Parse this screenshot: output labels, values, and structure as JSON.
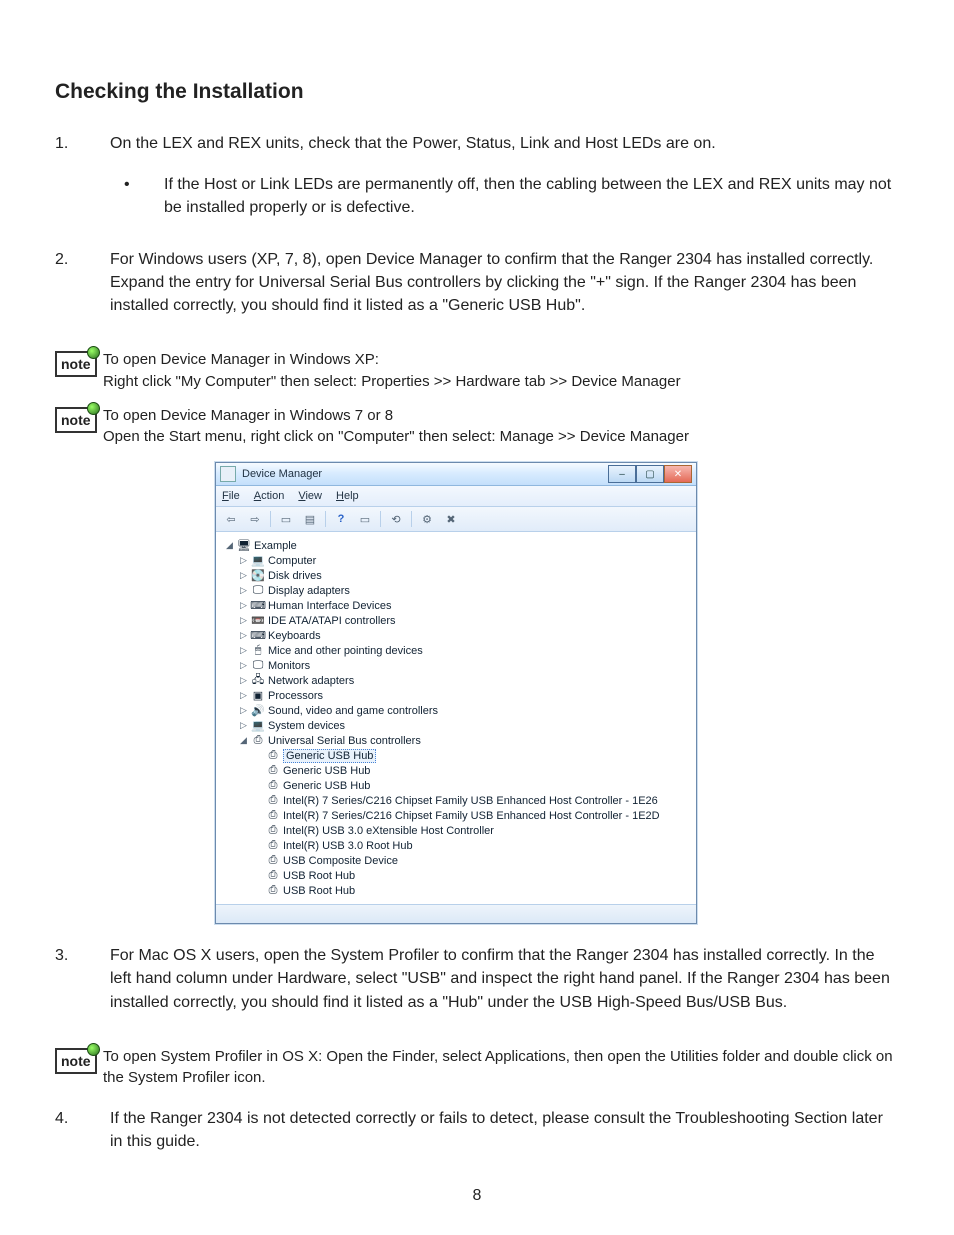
{
  "heading": "Checking the Installation",
  "items": {
    "i1": {
      "num": "1.",
      "text": "On the LEX and REX units, check that the Power, Status, Link and Host LEDs are on."
    },
    "i1b": {
      "text": "If the Host or Link LEDs are permanently off, then the cabling between the LEX and REX units may not be installed properly or is defective."
    },
    "i2": {
      "num": "2.",
      "text": "For Windows users (XP, 7, 8), open Device Manager to confirm that the Ranger 2304 has installed correctly. Expand the entry for Universal Serial Bus controllers by clicking the \"+\" sign. If the Ranger 2304 has been installed correctly, you should find it listed as a \"Generic USB Hub\"."
    },
    "i3": {
      "num": "3.",
      "text": "For Mac OS X users, open the System Profiler to confirm that the Ranger 2304 has installed correctly. In the left hand column under Hardware, select \"USB\" and inspect the right hand panel. If the Ranger 2304 has been installed correctly, you should find it listed as a \"Hub\" under the USB High-Speed Bus/USB Bus."
    },
    "i4": {
      "num": "4.",
      "text": "If the Ranger 2304 is not detected correctly or fails to detect, please consult the Troubleshooting Section later in this  guide."
    }
  },
  "notes": {
    "label": "note",
    "n1a": "To open Device Manager in Windows XP:",
    "n1b": "Right click \"My Computer\" then select:  Properties >> Hardware tab >>  Device Manager",
    "n2a": "To open Device Manager in Windows 7 or 8",
    "n2b": "Open the Start menu, right click on \"Computer\" then select:  Manage >> Device Manager",
    "n3": "To open System Profiler in OS X: Open the Finder, select Applications, then open the Utilities folder and double click on the System Profiler icon."
  },
  "pagenum": "8",
  "dm": {
    "title": "Device Manager",
    "menu": {
      "file": "File",
      "action": "Action",
      "view": "View",
      "help": "Help"
    },
    "root": "Example",
    "cats": {
      "c0": "Computer",
      "c1": "Disk drives",
      "c2": "Display adapters",
      "c3": "Human Interface Devices",
      "c4": "IDE ATA/ATAPI controllers",
      "c5": "Keyboards",
      "c6": "Mice and other pointing devices",
      "c7": "Monitors",
      "c8": "Network adapters",
      "c9": "Processors",
      "c10": "Sound, video and game controllers",
      "c11": "System devices",
      "c12": "Universal Serial Bus controllers"
    },
    "usb": {
      "u0": "Generic USB Hub",
      "u1": "Generic USB Hub",
      "u2": "Generic USB Hub",
      "u3": "Intel(R) 7 Series/C216 Chipset Family USB Enhanced Host Controller - 1E26",
      "u4": "Intel(R) 7 Series/C216 Chipset Family USB Enhanced Host Controller - 1E2D",
      "u5": "Intel(R) USB 3.0 eXtensible Host Controller",
      "u6": "Intel(R) USB 3.0 Root Hub",
      "u7": "USB Composite Device",
      "u8": "USB Root Hub",
      "u9": "USB Root Hub"
    }
  }
}
